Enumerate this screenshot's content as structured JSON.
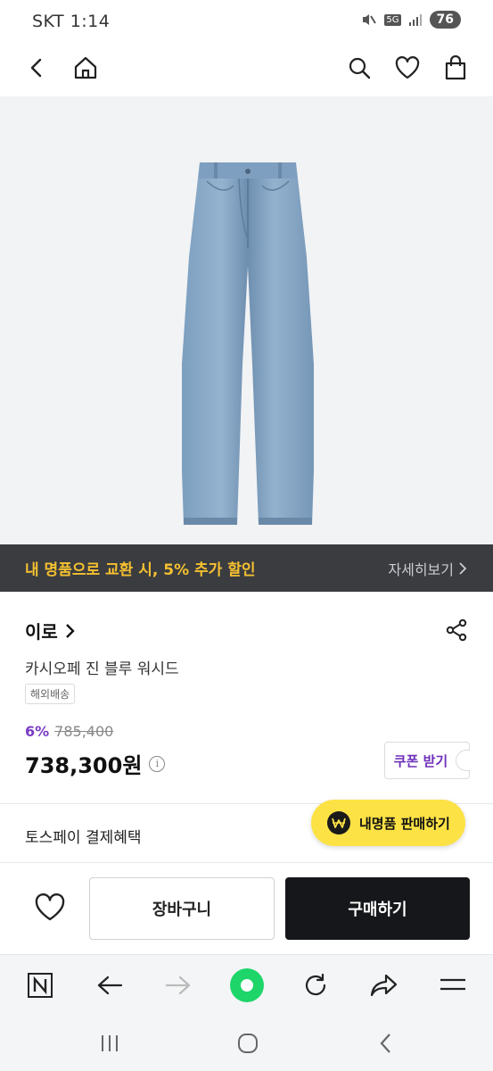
{
  "status_bar": {
    "time": "SKT 1:14",
    "network": "5G",
    "battery": "76"
  },
  "nav": {
    "back": "back-icon",
    "home": "home-icon",
    "search": "search-icon",
    "wishlist": "heart-icon",
    "cart": "shopping-bag-icon"
  },
  "promo": {
    "text": "내 명품으로 교환 시, 5% 추가 할인",
    "link": "자세히보기"
  },
  "product": {
    "brand": "이로",
    "name": "카시오페 진 블루 워시드",
    "shipping_badge": "해외배송",
    "discount_rate": "6%",
    "original_price": "785,400",
    "sale_price": "738,300원",
    "coupon_label": "쿠폰 받기"
  },
  "payment": {
    "label": "토스페이 결제혜택"
  },
  "sell_button": {
    "label": "내명품 판매하기"
  },
  "purchase": {
    "cart_label": "장바구니",
    "buy_label": "구매하기"
  },
  "colors": {
    "accent_purple": "#7a3cc5",
    "promo_yellow": "#f5c030",
    "fab_yellow": "#fce245",
    "buy_black": "#15171a"
  }
}
